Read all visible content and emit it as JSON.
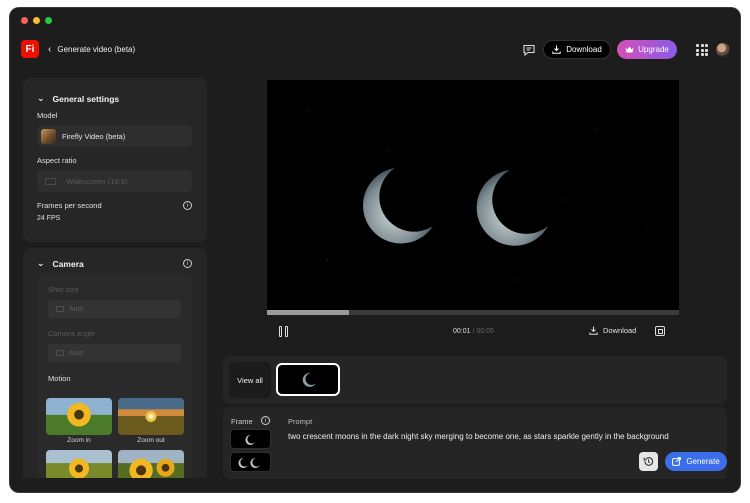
{
  "window": {
    "traffic_lights": [
      "#fe5f57",
      "#febc2e",
      "#28c840"
    ]
  },
  "topbar": {
    "app_logo": "Fi",
    "back_label": "Generate video (beta)",
    "download_label": "Download",
    "upgrade_label": "Upgrade",
    "icons": [
      "feedback-icon",
      "download-icon",
      "crown-icon",
      "apps-grid-icon",
      "user-avatar"
    ]
  },
  "general_settings": {
    "title": "General settings",
    "model_label": "Model",
    "model_value": "Firefly Video (beta)",
    "aspect_label": "Aspect ratio",
    "aspect_value": "Widescreen (16:9)",
    "fps_label": "Frames per second",
    "fps_value": "24 FPS"
  },
  "camera": {
    "title": "Camera",
    "shot_size_label": "Shot size",
    "shot_size_value": "Auto",
    "camera_angle_label": "Camera angle",
    "camera_angle_value": "Auto",
    "motion_label": "Motion",
    "motion_options": [
      "Zoom in",
      "Zoom out"
    ]
  },
  "player": {
    "current_time": "00:01",
    "total_time": "00:05",
    "progress": 0.2,
    "download_label": "Download"
  },
  "history": {
    "view_all_label": "View all"
  },
  "prompt_panel": {
    "frame_label": "Frame",
    "prompt_label": "Prompt",
    "prompt_text": "two crescent moons in the dark night sky merging to become one, as stars sparkle gently in the background",
    "generate_label": "Generate"
  },
  "colors": {
    "accent_blue": "#3b6ee8",
    "logo_red": "#eb1000",
    "upgrade_gradient": [
      "#d44fb6",
      "#8a5be6"
    ]
  }
}
